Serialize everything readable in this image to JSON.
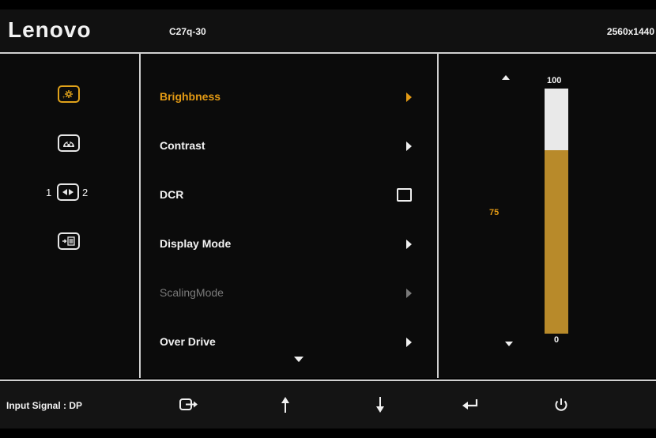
{
  "header": {
    "brand": "Lenovo",
    "model": "C27q-30",
    "resolution": "2560x1440"
  },
  "sidebar": {
    "icons": [
      {
        "name": "brightness-contrast-icon",
        "active": true
      },
      {
        "name": "color-icon",
        "active": false
      },
      {
        "name": "input-source-icon",
        "active": false,
        "left_label": "1",
        "right_label": "2"
      },
      {
        "name": "menu-settings-icon",
        "active": false
      }
    ]
  },
  "menu": {
    "items": [
      {
        "label": "Brighbness",
        "control": "arrow",
        "state": "selected"
      },
      {
        "label": "Contrast",
        "control": "arrow",
        "state": "normal"
      },
      {
        "label": "DCR",
        "control": "checkbox",
        "state": "normal"
      },
      {
        "label": "Display Mode",
        "control": "arrow",
        "state": "normal"
      },
      {
        "label": "ScalingMode",
        "control": "arrow",
        "state": "disabled"
      },
      {
        "label": "Over Drive",
        "control": "arrow",
        "state": "normal"
      }
    ]
  },
  "value_panel": {
    "max_label": "100",
    "min_label": "0",
    "current_label": "75",
    "level_percent": 75
  },
  "footer": {
    "input_signal": "Input Signal : DP",
    "buttons": [
      "input-switch-icon",
      "up-arrow-icon",
      "down-arrow-icon",
      "enter-icon",
      "power-icon"
    ]
  },
  "colors": {
    "accent": "#e39a14",
    "bar_fill": "#b88a2a",
    "bar_track": "#e9e9e9",
    "background": "#0b0b0b"
  }
}
